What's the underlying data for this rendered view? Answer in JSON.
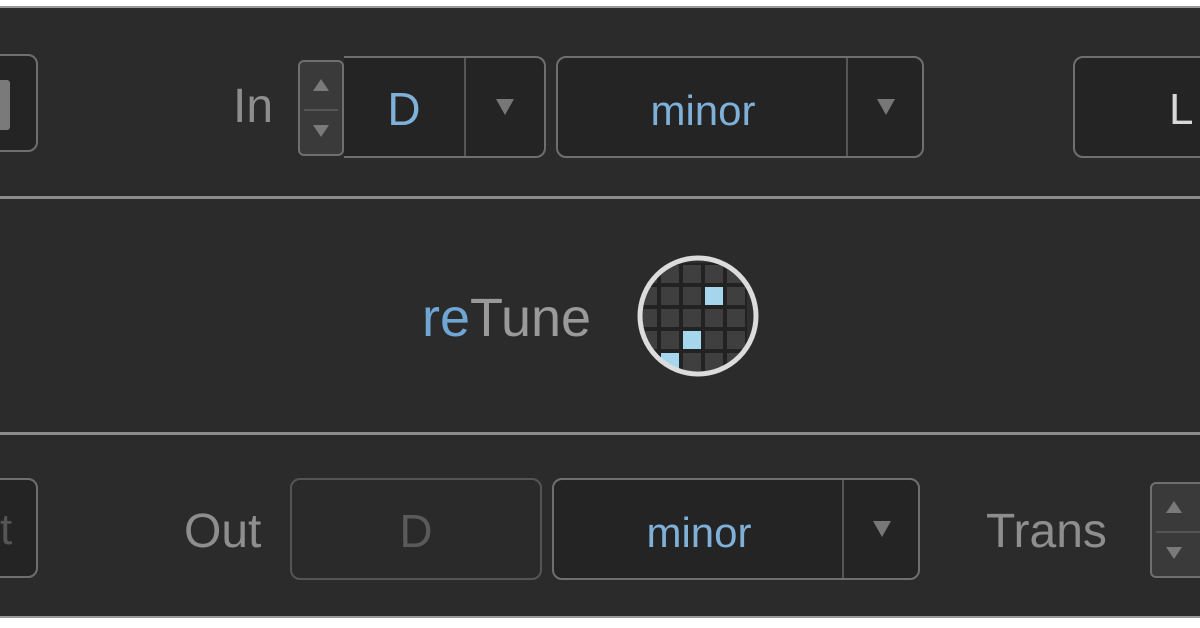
{
  "top": {
    "in_label": "In",
    "key": "D",
    "scale": "minor",
    "right_button_label": "L"
  },
  "brand": {
    "prefix": "re",
    "suffix": "Tune"
  },
  "bottom": {
    "left_partial": "t",
    "out_label": "Out",
    "key": "D",
    "scale": "minor",
    "trans_label": "Trans"
  },
  "colors": {
    "panel": "#2b2b2b",
    "accent_blue": "#7fb0d8",
    "label_gray": "#8e8e8e"
  }
}
